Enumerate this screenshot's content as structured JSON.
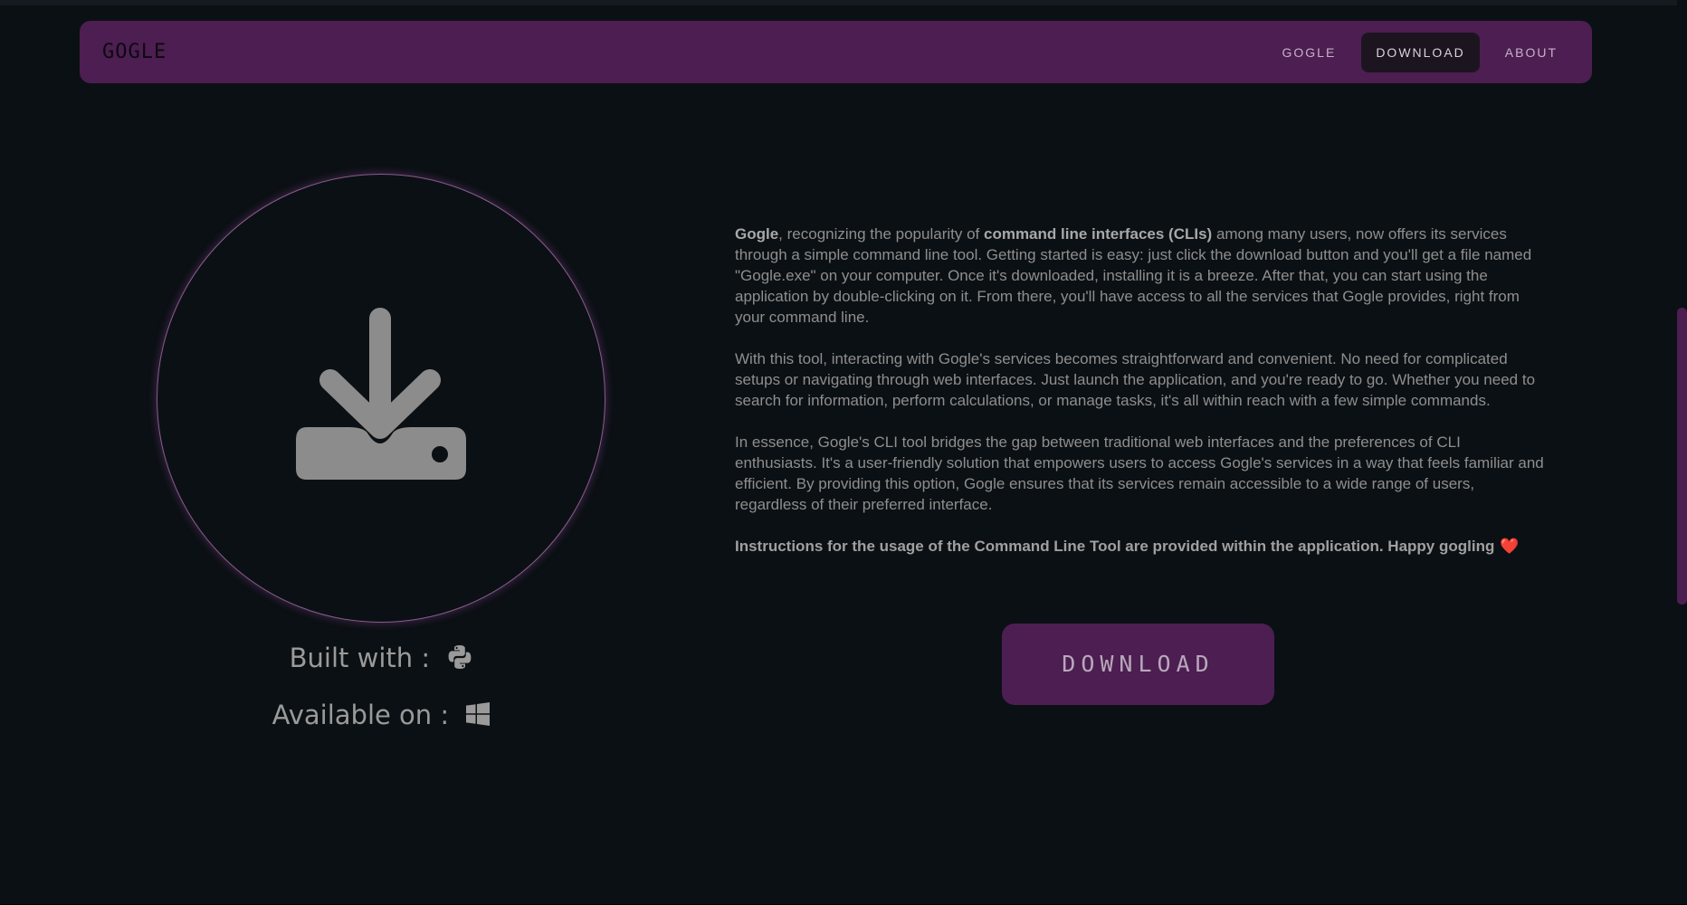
{
  "nav": {
    "logo": "GOGLE",
    "links": [
      {
        "label": "GOGLE"
      },
      {
        "label": "DOWNLOAD"
      },
      {
        "label": "ABOUT"
      }
    ]
  },
  "hero": {
    "icon": "download-tray-icon",
    "built_with_label": "Built with :",
    "built_with_icon": "python-icon",
    "available_on_label": "Available on :",
    "available_on_icon": "windows-icon"
  },
  "content": {
    "p1_bold1": "Gogle",
    "p1_text1": ", recognizing the popularity of ",
    "p1_bold2": "command line interfaces (CLIs)",
    "p1_text2": " among many users, now offers its services through a simple command line tool. Getting started is easy: just click the download button and you'll get a file named \"Gogle.exe\" on your computer. Once it's downloaded, installing it is a breeze. After that, you can start using the application by double-clicking on it. From there, you'll have access to all the services that Gogle provides, right from your command line.",
    "p2": "With this tool, interacting with Gogle's services becomes straightforward and convenient. No need for complicated setups or navigating through web interfaces. Just launch the application, and you're ready to go. Whether you need to search for information, perform calculations, or manage tasks, it's all within reach with a few simple commands.",
    "p3": "In essence, Gogle's CLI tool bridges the gap between traditional web interfaces and the preferences of CLI enthusiasts. It's a user-friendly solution that empowers users to access Gogle's services in a way that feels familiar and efficient. By providing this option, Gogle ensures that its services remain accessible to a wide range of users, regardless of their preferred interface.",
    "instructions": "Instructions for the usage of the Command Line Tool are provided within the application. Happy gogling",
    "heart": "❤️"
  },
  "download_button": {
    "label": "DOWNLOAD"
  },
  "colors": {
    "accent": "#4d1e52",
    "background": "#0b1014"
  }
}
